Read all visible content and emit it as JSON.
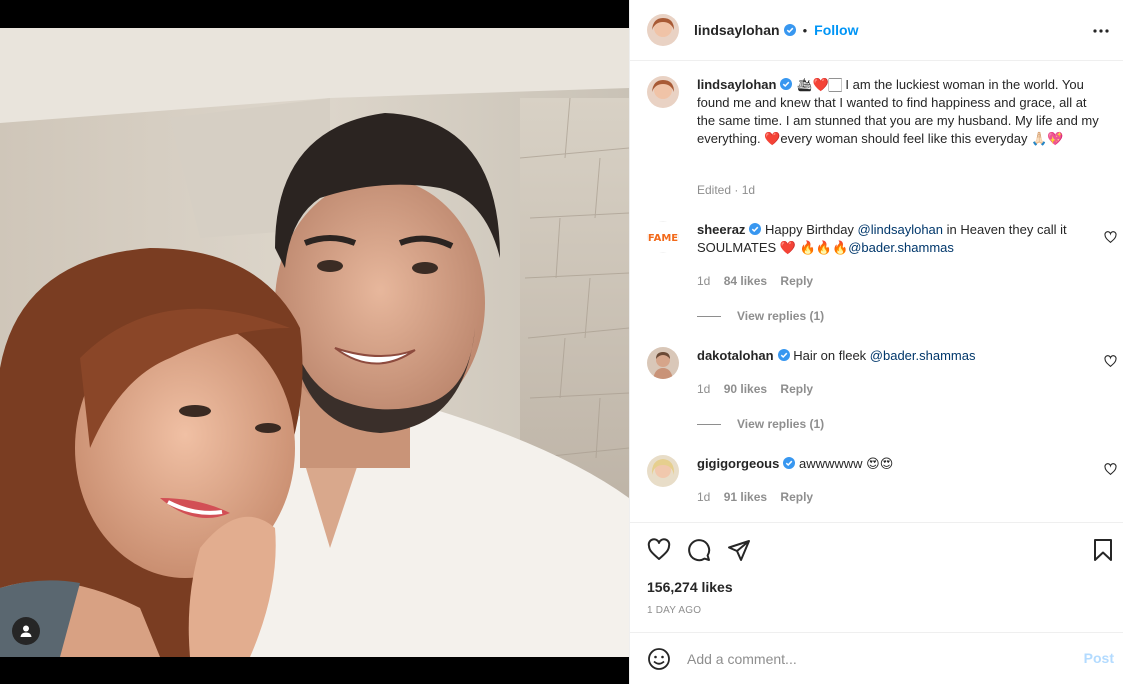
{
  "header": {
    "username": "lindsaylohan",
    "separator": "•",
    "follow_label": "Follow"
  },
  "caption": {
    "username": "lindsaylohan",
    "text": "🛳❤️🏻 I am the luckiest woman in the world. You found me and knew that I wanted to find happiness and grace, all at the same time. I am stunned that you are my husband. My life and my everything. ❤️every woman should feel like this everyday 🙏🏻💖",
    "meta": "Edited · 1d"
  },
  "comments": [
    {
      "username": "sheeraz",
      "text_before": "Happy Birthday ",
      "mention1": "@lindsaylohan",
      "text_middle": " in Heaven they call it SOULMATES ❤️ ",
      "emoji": "🔥🔥🔥",
      "mention2": "@bader.shammas",
      "time": "1d",
      "likes": "84 likes",
      "reply": "Reply",
      "view_replies": "View replies (1)"
    },
    {
      "username": "dakotalohan",
      "text_before": "Hair on fleek ",
      "mention1": "@bader.shammas",
      "time": "1d",
      "likes": "90 likes",
      "reply": "Reply",
      "view_replies": "View replies (1)"
    },
    {
      "username": "gigigorgeous",
      "text_before": "awwwwww 😍😍",
      "time": "1d",
      "likes": "91 likes",
      "reply": "Reply"
    }
  ],
  "actions": {
    "likes": "156,274 likes",
    "time_ago": "1 DAY AGO"
  },
  "add_comment": {
    "placeholder": "Add a comment...",
    "post_label": "Post"
  },
  "colors": {
    "accent": "#0095f6",
    "verified": "#3897f0",
    "muted": "#8e8e8e",
    "mention": "#00376b"
  }
}
